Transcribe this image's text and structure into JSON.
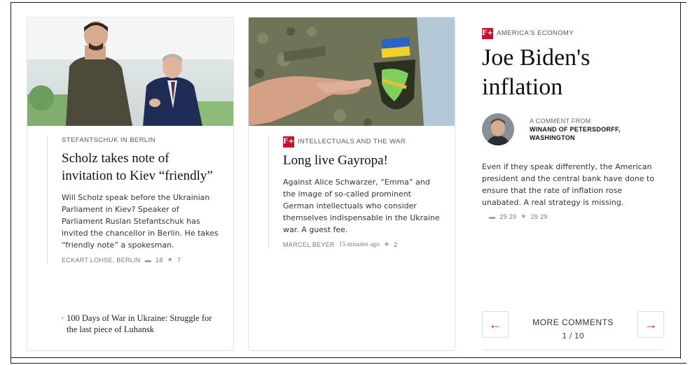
{
  "cards": [
    {
      "kicker": "STEFANTSCHUK IN BERLIN",
      "headline": "Scholz takes note of invitation to Kiev “friendly”",
      "teaser": "Will Scholz speak before the Ukrainian Parliament in Kiev? Speaker of Parliament Ruslan Stefantschuk has invited the chancellor in Berlin. He takes “friendly note” a spokesman.",
      "author": "ECKART LOHSE, BERLIN",
      "comments": "18",
      "stars": "7",
      "related": "100 Days of War in Ukraine: Struggle for the last piece of Luhansk"
    },
    {
      "badge": "F+",
      "kicker": "INTELLECTUALS AND THE WAR",
      "headline": "Long live Gayropa!",
      "teaser": "Against Alice Schwarzer, “Emma” and the image of so-called prominent German intellectuals who consider themselves indispensable in the Ukraine war. A guest fee.",
      "author": "MARCEL BEYER",
      "time": "15 minutes ago",
      "stars": "2"
    }
  ],
  "opinion": {
    "badge": "F+",
    "kicker": "AMERICA'S ECONOMY",
    "headline": "Joe Biden's inflation",
    "comment_label": "A COMMENT FROM",
    "author": "WINAND OF PETERSDORFF, WASHINGTON",
    "teaser": "Even if they speak differently, the American president and the central bank have done to ensure that the rate of inflation rose unabated. A real strategy is missing.",
    "comments": "29 29",
    "stars": "29 29"
  },
  "more_comments": {
    "label": "MORE COMMENTS",
    "page": "1 / 10",
    "prev_icon": "←",
    "next_icon": "→"
  },
  "colors": {
    "accent": "#c8102e"
  }
}
